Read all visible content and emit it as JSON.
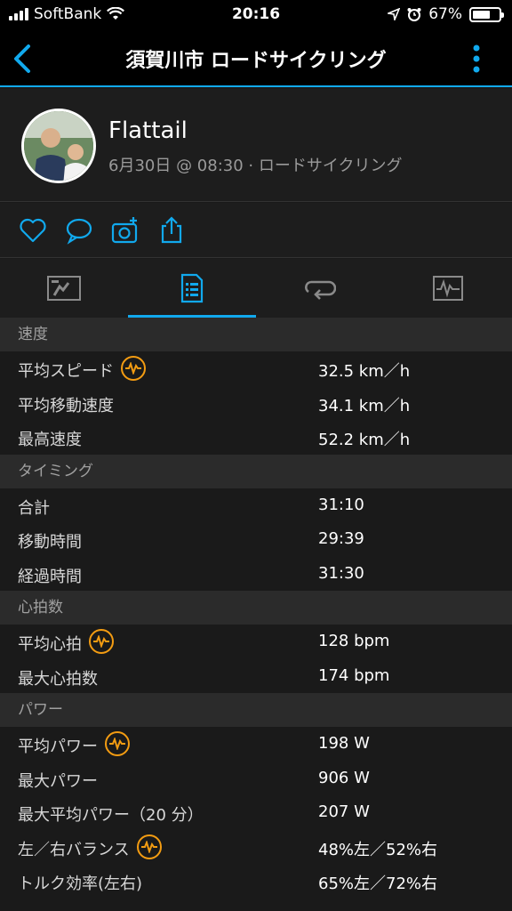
{
  "status_bar": {
    "carrier": "SoftBank",
    "time": "20:16",
    "battery": "67%",
    "battery_level": 0.67
  },
  "nav": {
    "title": "須賀川市 ロードサイクリング"
  },
  "profile": {
    "name": "Flattail",
    "subtitle": "6月30日 @ 08:30 · ロードサイクリング"
  },
  "actions": [
    "heart-icon",
    "comment-icon",
    "add-photo-icon",
    "share-icon"
  ],
  "tabs": [
    "summary-map-icon",
    "details-list-icon",
    "laps-icon",
    "charts-icon"
  ],
  "sections": [
    {
      "title": "速度",
      "rows": [
        {
          "label": "平均スピード",
          "value": "32.5 km／h",
          "badge": true
        },
        {
          "label": "平均移動速度",
          "value": "34.1 km／h"
        },
        {
          "label": "最高速度",
          "value": "52.2 km／h"
        }
      ]
    },
    {
      "title": "タイミング",
      "rows": [
        {
          "label": "合計",
          "value": "31:10"
        },
        {
          "label": "移動時間",
          "value": "29:39"
        },
        {
          "label": "経過時間",
          "value": "31:30"
        }
      ]
    },
    {
      "title": "心拍数",
      "rows": [
        {
          "label": "平均心拍",
          "value": "128 bpm",
          "badge": true
        },
        {
          "label": "最大心拍数",
          "value": "174 bpm"
        }
      ]
    },
    {
      "title": "パワー",
      "rows": [
        {
          "label": "平均パワー",
          "value": "198 W",
          "badge": true
        },
        {
          "label": "最大パワー",
          "value": "906 W"
        },
        {
          "label": "最大平均パワー（20 分）",
          "value": "207 W"
        },
        {
          "label": "左／右バランス",
          "value": "48%左／52%右",
          "badge": true
        },
        {
          "label": "トルク効率(左右)",
          "value": "65%左／72%右"
        }
      ]
    }
  ]
}
